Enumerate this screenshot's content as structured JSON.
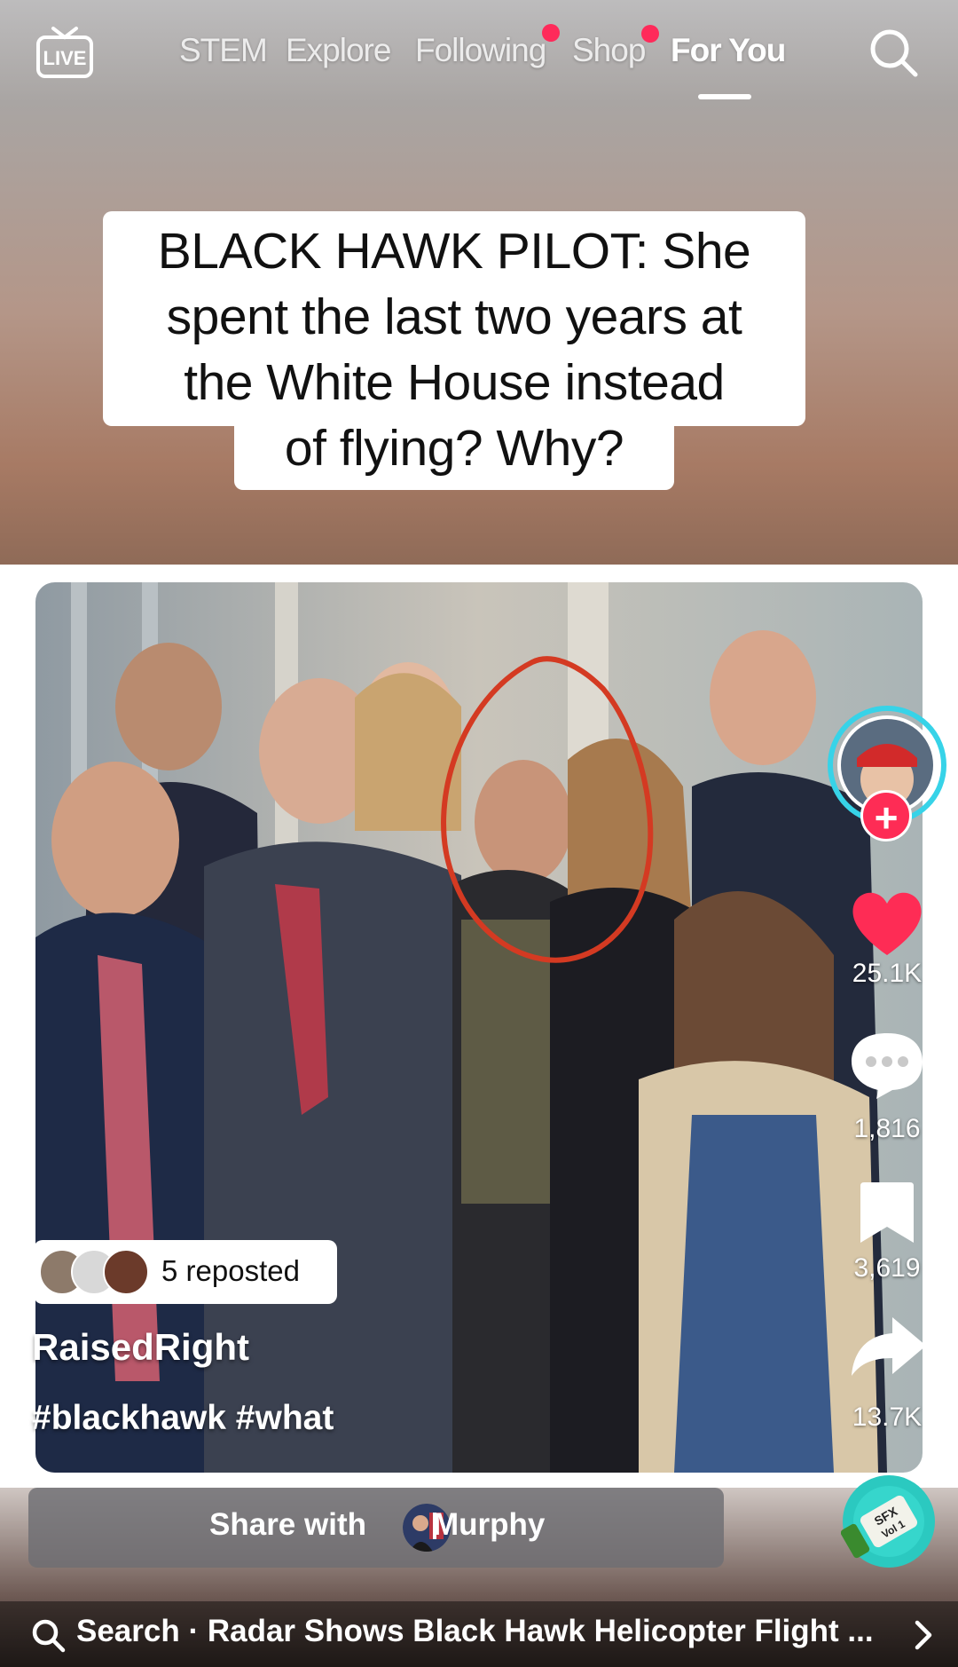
{
  "header": {
    "tabs": [
      {
        "label": "STEM",
        "active": false,
        "dot": false
      },
      {
        "label": "Explore",
        "active": false,
        "dot": false
      },
      {
        "label": "Following",
        "active": false,
        "dot": true
      },
      {
        "label": "Shop",
        "active": false,
        "dot": true
      },
      {
        "label": "For You",
        "active": true,
        "dot": false
      }
    ],
    "live_label": "LIVE",
    "live_icon": "live-tv-icon",
    "search_icon": "search-icon",
    "accent_color": "#fe2c55"
  },
  "video": {
    "caption_lines": [
      "BLACK HAWK PILOT: She",
      "spent the last two years at",
      "the White House instead",
      "of flying? Why?"
    ],
    "author": "RaisedRight",
    "hashtags": "#blackhawk #what",
    "reposted_label": "5 reposted"
  },
  "actions": {
    "likes": "25.1K",
    "comments": "1,816",
    "saves": "3,619",
    "shares": "13.7K",
    "follow_icon": "plus-icon",
    "like_icon": "heart-icon",
    "comment_icon": "comment-bubble-icon",
    "save_icon": "bookmark-icon",
    "share_icon": "share-arrow-icon"
  },
  "share_bar": {
    "prefix": "Share with",
    "name": "Murphy"
  },
  "bottom_search": {
    "text": "Search · Radar Shows Black Hawk Helicopter Flight ...",
    "icon": "search-icon",
    "chevron": "chevron-right-icon"
  },
  "music_disc": {
    "label_line1": "SFX",
    "label_line2": "Vol 1"
  }
}
